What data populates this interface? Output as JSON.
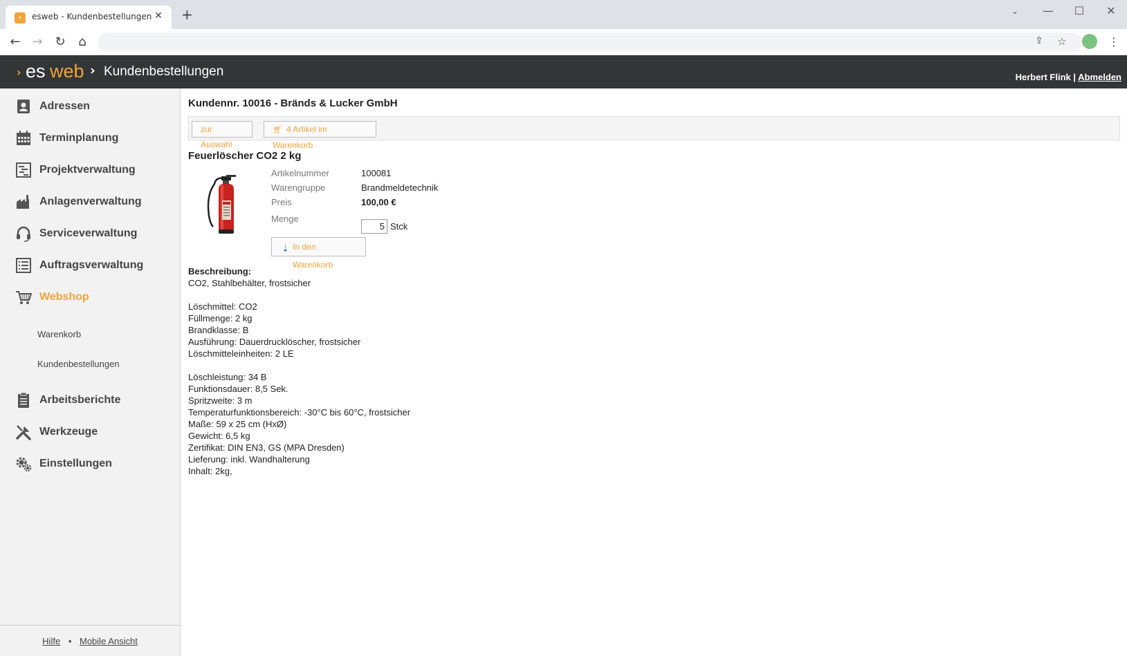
{
  "browser": {
    "tab_title": "esweb - Kundenbestellungen",
    "tab_close": "✕",
    "new_tab": "+"
  },
  "header": {
    "logo_es": "es",
    "logo_web": "web",
    "title": "Kundenbestellungen",
    "user_name": "Herbert Flink",
    "separator": " | ",
    "logout": "Abmelden"
  },
  "sidebar": {
    "items": [
      {
        "label": "Adressen",
        "icon": "address-book-icon"
      },
      {
        "label": "Terminplanung",
        "icon": "calendar-icon"
      },
      {
        "label": "Projektverwaltung",
        "icon": "gantt-chart-icon"
      },
      {
        "label": "Anlagenverwaltung",
        "icon": "factory-icon"
      },
      {
        "label": "Serviceverwaltung",
        "icon": "headset-icon"
      },
      {
        "label": "Auftragsverwaltung",
        "icon": "list-icon"
      },
      {
        "label": "Webshop",
        "icon": "cart-icon"
      },
      {
        "label": "Arbeitsberichte",
        "icon": "clipboard-icon"
      },
      {
        "label": "Werkzeuge",
        "icon": "tools-icon"
      },
      {
        "label": "Einstellungen",
        "icon": "gears-icon"
      }
    ],
    "sub_items": [
      "Warenkorb",
      "Kundenbestellungen"
    ],
    "footer": {
      "help": "Hilfe",
      "bullet": "•",
      "mobile": "Mobile Ansicht"
    }
  },
  "main": {
    "customer_title": "Kundennr. 10016 - Bränds & Lucker GmbH",
    "back_button": "zur Auswahl",
    "cart_button": "4 Artikel im Warenkorb",
    "product_title": "Feuerlöscher CO2 2 kg",
    "attributes": {
      "article_no_label": "Artikelnummer",
      "article_no": "100081",
      "group_label": "Warengruppe",
      "group": "Brandmeldetechnik",
      "price_label": "Preis",
      "price": "100,00 €",
      "quantity_label": "Menge",
      "quantity": "5",
      "unit": "Stck"
    },
    "add_to_cart": "In den Warenkorb",
    "description_heading": "Beschreibung:",
    "description_lines": [
      "CO2, Stahlbehälter, frostsicher",
      "",
      "Löschmittel: CO2",
      "Füllmenge: 2 kg",
      "Brandklasse: B",
      "Ausführung: Dauerdrucklöscher, frostsicher",
      "Löschmitteleinheiten: 2 LE",
      "",
      "Löschleistung: 34 B",
      "Funktionsdauer: 8,5 Sek.",
      "Spritzweite: 3 m",
      "Temperaturfunktionsbereich: -30°C bis 60°C, frostsicher",
      "Maße: 59 x 25 cm (HxØ)",
      "Gewicht: 6,5 kg",
      "Zertifikat: DIN EN3, GS (MPA Dresden)",
      "Lieferung: inkl. Wandhalterung",
      "Inhalt: 2kg,"
    ]
  },
  "colors": {
    "accent": "#f2a33a",
    "header_bg": "#323637",
    "sidebar_bg": "#f2f2f2"
  }
}
